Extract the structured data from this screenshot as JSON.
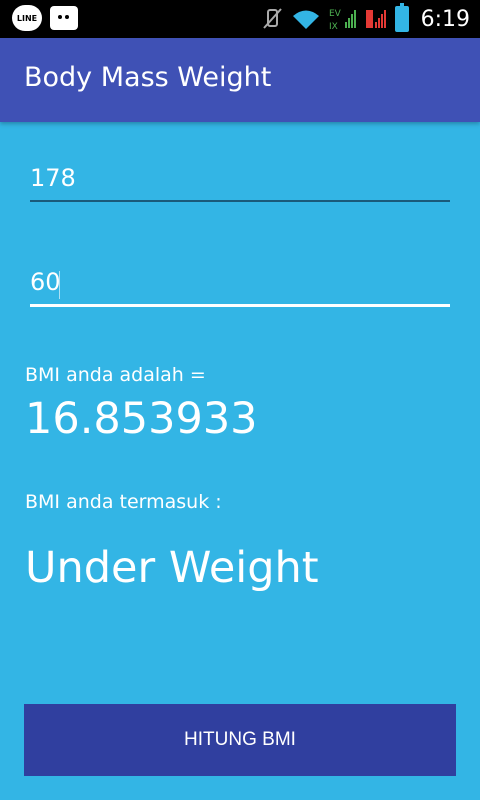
{
  "status_bar": {
    "time": "6:19",
    "line_app_label": "LINE",
    "network_labels": [
      "EV",
      "IX"
    ]
  },
  "app_bar": {
    "title": "Body Mass Weight"
  },
  "form": {
    "height_value": "178",
    "weight_value": "60"
  },
  "result": {
    "bmi_label": "BMI anda adalah =",
    "bmi_value": "16.853933",
    "category_label": "BMI anda termasuk :",
    "category_value": "Under Weight"
  },
  "actions": {
    "calculate_label": "HITUNG BMI"
  },
  "colors": {
    "background": "#33b5e5",
    "app_bar": "#3f51b5",
    "button": "#303f9f",
    "status_bar": "#000000"
  }
}
